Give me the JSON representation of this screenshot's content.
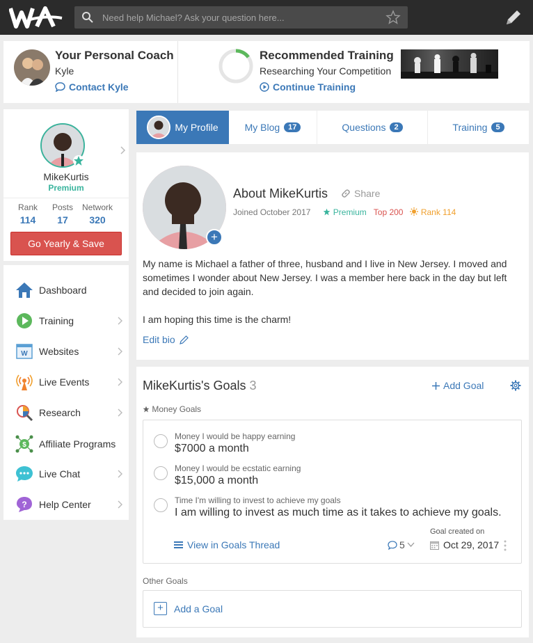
{
  "search": {
    "placeholder": "Need help Michael? Ask your question here..."
  },
  "coach": {
    "title": "Your Personal Coach",
    "name": "Kyle",
    "contact_label": "Contact Kyle"
  },
  "training": {
    "title": "Recommended Training",
    "subtitle": "Researching Your Competition",
    "continue_label": "Continue Training",
    "progress_fraction": 0.15
  },
  "profile": {
    "username": "MikeKurtis",
    "tier": "Premium",
    "stats": [
      {
        "label": "Rank",
        "value": "114"
      },
      {
        "label": "Posts",
        "value": "17"
      },
      {
        "label": "Network",
        "value": "320"
      }
    ],
    "upgrade_label": "Go Yearly & Save"
  },
  "nav": [
    {
      "label": "Dashboard",
      "icon": "house-icon"
    },
    {
      "label": "Training",
      "icon": "play-icon"
    },
    {
      "label": "Websites",
      "icon": "website-icon"
    },
    {
      "label": "Live Events",
      "icon": "broadcast-icon"
    },
    {
      "label": "Research",
      "icon": "research-icon"
    },
    {
      "label": "Affiliate Programs",
      "icon": "affiliate-icon"
    },
    {
      "label": "Live Chat",
      "icon": "chat-icon"
    },
    {
      "label": "Help Center",
      "icon": "help-icon"
    }
  ],
  "tabs": [
    {
      "label": "My Profile",
      "badge": ""
    },
    {
      "label": "My Blog",
      "badge": "17"
    },
    {
      "label": "Questions",
      "badge": "2"
    },
    {
      "label": "Training",
      "badge": "5"
    }
  ],
  "about": {
    "title": "About MikeKurtis",
    "share_label": "Share",
    "joined": "Joined October 2017",
    "premium": "Premium",
    "top": "Top 200",
    "rank": "Rank 114",
    "bio_p1": "My name is Michael a father of three, husband and I live in New Jersey. I moved and sometimes I wonder about New Jersey. I was a member here back in the day but left and decided to join again.",
    "bio_p2": "I am hoping this time is the charm!",
    "edit_label": "Edit bio"
  },
  "goals": {
    "title": "MikeKurtis's Goals",
    "count": "3",
    "add_label": "Add Goal",
    "section_label": "Money Goals",
    "items": [
      {
        "label": "Money I would be happy earning",
        "value": "$7000 a month"
      },
      {
        "label": "Money I would be ecstatic earning",
        "value": "$15,000 a month"
      },
      {
        "label": "Time I'm willing to invest to achieve my goals",
        "value": "I am willing to invest as much time as it takes to achieve my goals."
      }
    ],
    "thread_label": "View in Goals Thread",
    "comment_count": "5",
    "created_label": "Goal created on",
    "created_date": "Oct 29, 2017",
    "other_label": "Other Goals",
    "add_goal_label": "Add a Goal"
  },
  "colors": {
    "accent": "#3b78b7",
    "premium": "#39b49d",
    "danger": "#d9534f",
    "rank": "#f0a02e",
    "topbar": "#2b2b2b"
  }
}
